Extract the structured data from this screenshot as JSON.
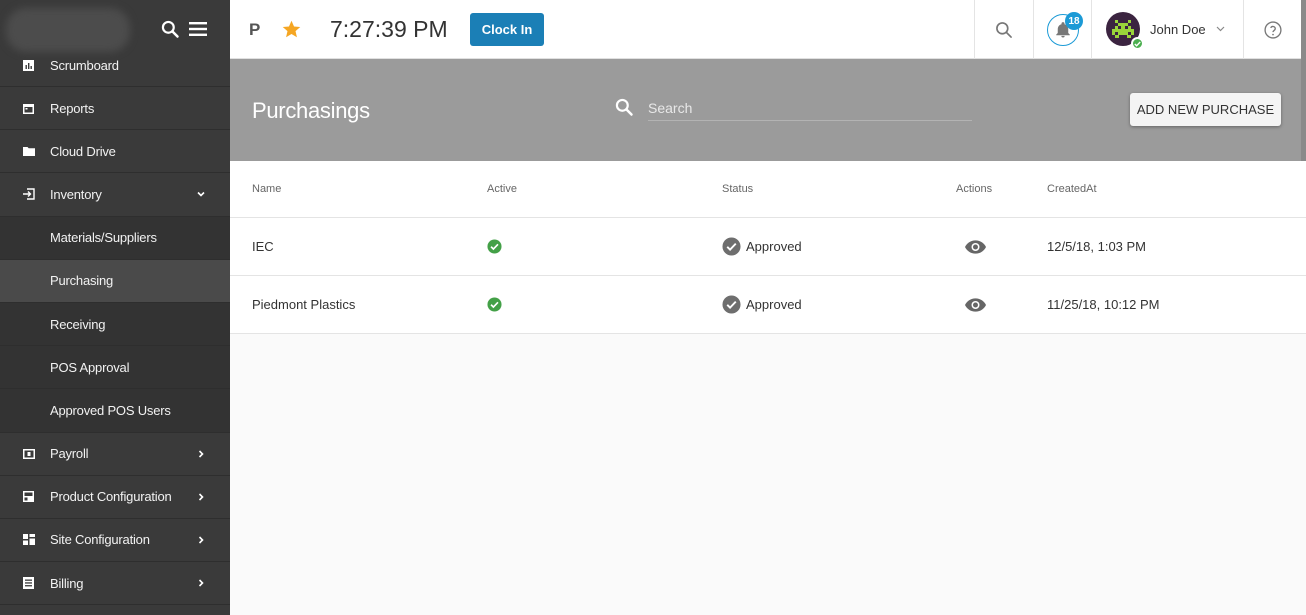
{
  "topbar": {
    "initial": "P",
    "time": "7:27:39 PM",
    "clock_in_label": "Clock In",
    "notification_count": "18",
    "user_name": "John Doe"
  },
  "sidebar": {
    "items": [
      {
        "label": "Scrumboard",
        "icon": "chart-icon"
      },
      {
        "label": "Reports",
        "icon": "calendar-icon"
      },
      {
        "label": "Cloud Drive",
        "icon": "folder-icon"
      },
      {
        "label": "Inventory",
        "icon": "inventory-icon"
      },
      {
        "label": "Materials/Suppliers"
      },
      {
        "label": "Purchasing"
      },
      {
        "label": "Receiving"
      },
      {
        "label": "POS Approval"
      },
      {
        "label": "Approved POS Users"
      },
      {
        "label": "Payroll",
        "icon": "payroll-icon"
      },
      {
        "label": "Product Configuration",
        "icon": "product-icon"
      },
      {
        "label": "Site Configuration",
        "icon": "site-icon"
      },
      {
        "label": "Billing",
        "icon": "billing-icon"
      }
    ]
  },
  "page": {
    "title": "Purchasings",
    "search_placeholder": "Search",
    "add_button": "ADD NEW PURCHASE"
  },
  "table": {
    "columns": [
      "Name",
      "Active",
      "Status",
      "Actions",
      "CreatedAt"
    ],
    "rows": [
      {
        "name": "IEC",
        "status": "Approved",
        "created": "12/5/18, 1:03 PM"
      },
      {
        "name": "Piedmont Plastics",
        "status": "Approved",
        "created": "11/25/18, 10:12 PM"
      }
    ]
  },
  "colors": {
    "accent": "#1b7fb6",
    "sidebar": "#3a3a3a",
    "header_band": "#9b9b9b",
    "success": "#43a047",
    "star": "#f5a623"
  }
}
